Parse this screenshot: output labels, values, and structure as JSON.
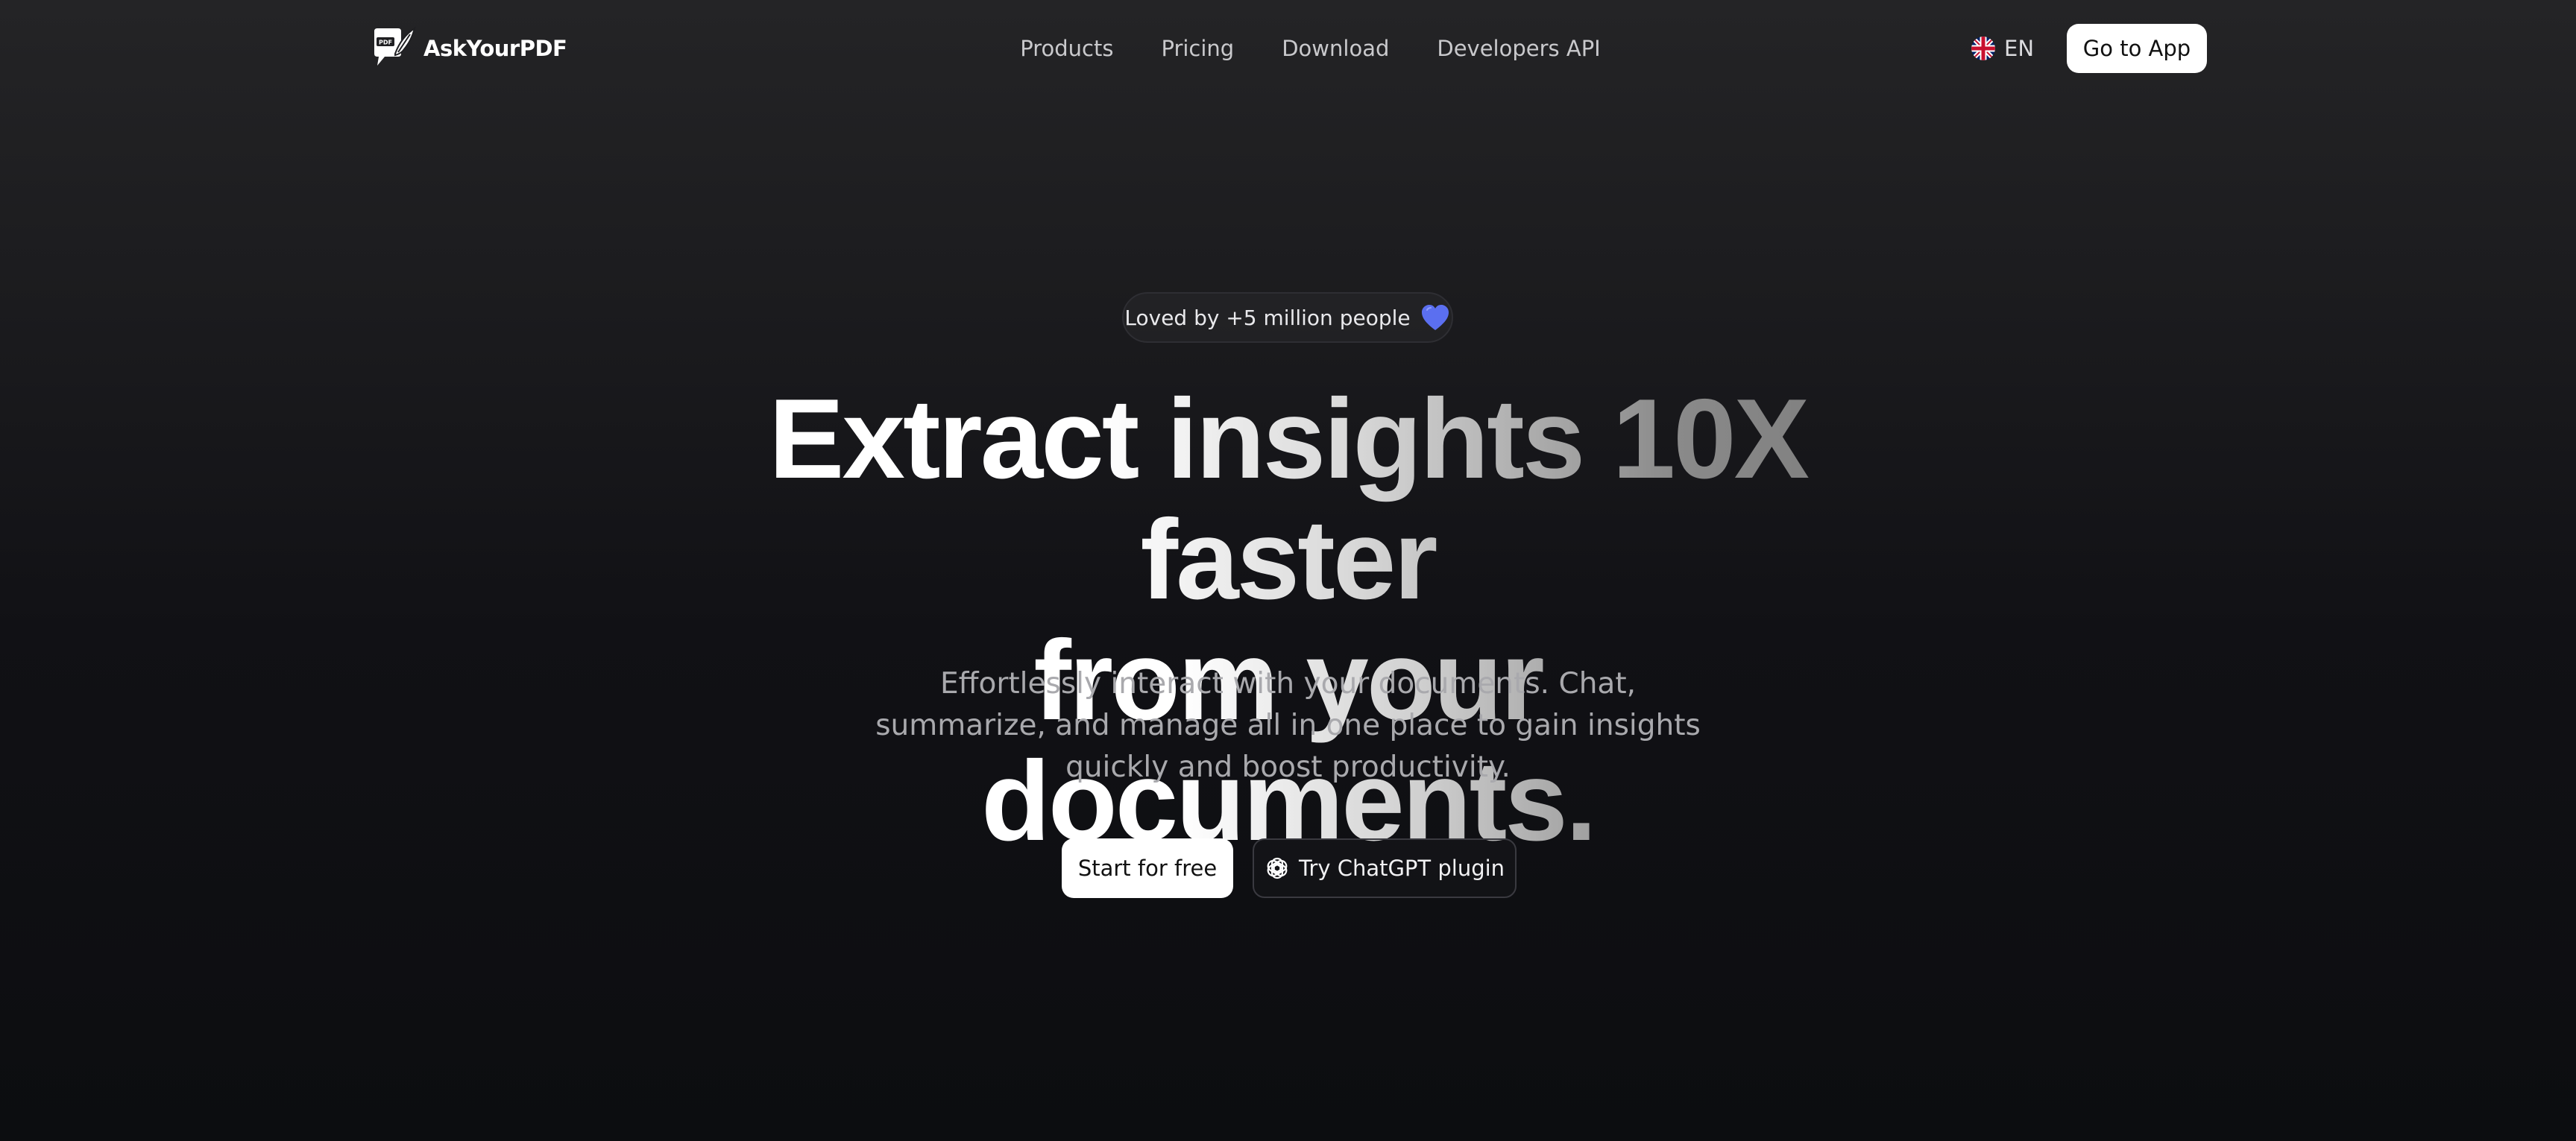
{
  "brand": {
    "name": "AskYourPDF",
    "logo_icon": "pdf-feather-logo-icon",
    "logo_badge_text": "PDF"
  },
  "nav": {
    "links": [
      "Products",
      "Pricing",
      "Download",
      "Developers API"
    ],
    "language": {
      "code": "EN",
      "icon": "uk-flag-icon"
    },
    "cta_label": "Go to App"
  },
  "hero": {
    "badge_text": "Loved by +5 million people",
    "badge_icon": "blue-heart-icon",
    "headline_line1": "Extract insights 10X faster",
    "headline_line2": "from your documents.",
    "subtitle": "Effortlessly interact with your documents. Chat, summarize, and manage all in one place to gain insights quickly and boost productivity.",
    "primary_cta": "Start for free",
    "secondary_cta": "Try ChatGPT plugin",
    "secondary_cta_icon": "openai-icon"
  },
  "colors": {
    "background_top": "#242426",
    "background_bottom": "#0c0d10",
    "accent_heart": "#5b6ff0",
    "text_muted": "#a9a9ad"
  }
}
